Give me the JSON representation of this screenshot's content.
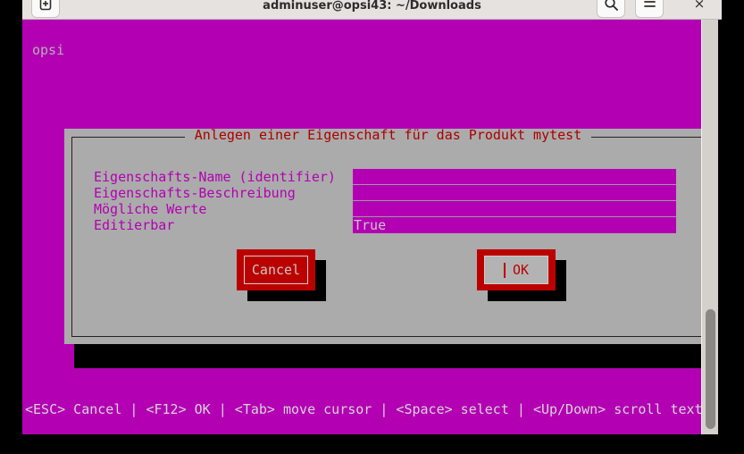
{
  "window": {
    "title": "adminuser@opsi43: ~/Downloads",
    "new_tab_icon": "plus-in-box-icon",
    "search_icon": "search-icon",
    "menu_icon": "hamburger-menu-icon",
    "close_label": "×"
  },
  "terminal": {
    "header_text": "opsi",
    "background_color": "#b300b3",
    "foreground_color": "#b2b2b2",
    "status_bar": "<ESC> Cancel | <F12> OK | <Tab> move cursor | <Space> select | <Up/Down> scroll text"
  },
  "dialog": {
    "title": "Anlegen einer Eigenschaft für das Produkt mytest",
    "title_color": "#aa0000",
    "background_color": "#ababab",
    "fields": [
      {
        "label": "Eigenschafts-Name (identifier)",
        "value": ""
      },
      {
        "label": "Eigenschafts-Beschreibung",
        "value": ""
      },
      {
        "label": "Mögliche Werte",
        "value": ""
      },
      {
        "label": "Editierbar",
        "value": "True"
      }
    ],
    "buttons": {
      "cancel_label": "Cancel",
      "ok_label": "OK",
      "button_color": "#bb0000",
      "focused": "ok"
    }
  }
}
